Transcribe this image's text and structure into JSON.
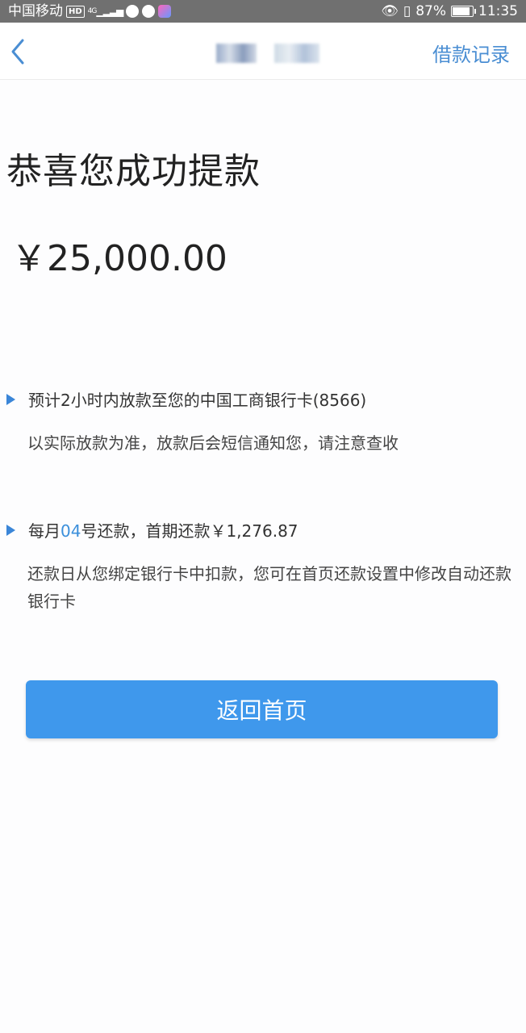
{
  "status_bar": {
    "carrier": "中国移动",
    "hd_badge": "HD",
    "network": "4G",
    "battery": "87%",
    "time": "11:35"
  },
  "nav": {
    "right_action": "借款记录"
  },
  "headline": "恭喜您成功提款",
  "amount": "￥25,000.00",
  "info1": {
    "main": "预计2小时内放款至您的中国工商银行卡(8566)",
    "sub": "以实际放款为准，放款后会短信通知您，请注意查收"
  },
  "info2": {
    "main_prefix": "每月",
    "day": "04",
    "main_suffix": "号还款，首期还款￥1,276.87",
    "sub": "还款日从您绑定银行卡中扣款，您可在首页还款设置中修改自动还款银行卡"
  },
  "button": {
    "label": "返回首页"
  },
  "colors": {
    "accent": "#3f98ec",
    "link": "#4a8ed3",
    "status_bar": "#707070"
  },
  "battery_level": 0.87
}
